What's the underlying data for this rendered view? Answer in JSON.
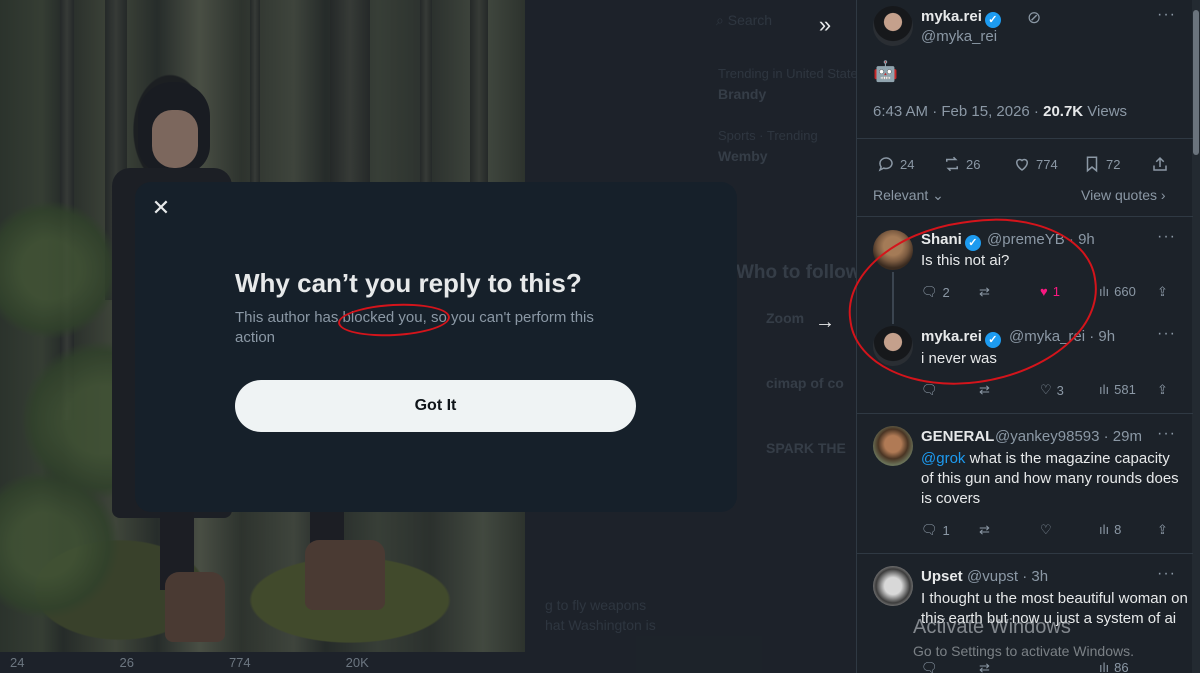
{
  "modal": {
    "title": "Why can’t you reply to this?",
    "text": "This author has blocked you, so you can't perform this action",
    "button": "Got It"
  },
  "background_column": {
    "search": "Search",
    "trending_label": "Trending in United States",
    "trending_topic": "Brandy",
    "sports_label": "Sports · Trending",
    "sports_topic": "Wemby",
    "who_to_follow": "Who to follow",
    "suggest_1": "Zoom",
    "suggest_2": "cimap of co",
    "suggest_3": "SPARK THE",
    "news_text": "g to fly weapons",
    "news_text2": "hat Washington is"
  },
  "photo_actions": {
    "replies": "24",
    "reposts": "26",
    "likes": "774",
    "views": "20K"
  },
  "post": {
    "author_name": "myka.rei",
    "author_handle": "@myka_rei",
    "emoji": "🤖",
    "time": "6:43 AM · Feb 15, 2026 · ",
    "views_count": "20.7K",
    "views_label": " Views",
    "replies": "24",
    "reposts": "26",
    "likes": "774",
    "bookmarks": "72",
    "sort": "Relevant",
    "view_quotes": "View quotes"
  },
  "replies": [
    {
      "name": "Shani",
      "handle": "@premeYB · 9h",
      "text": "Is this not ai?",
      "replies": "2",
      "reposts": "",
      "likes": "1",
      "views": "660"
    },
    {
      "name": "myka.rei",
      "handle": "@myka_rei · 9h",
      "text": "i never was",
      "replies": "",
      "reposts": "",
      "likes": "3",
      "views": "581"
    },
    {
      "name": "GENERAL",
      "handle": "@yankey98593 · 29m",
      "mention": "@grok",
      "text": " what is the magazine capacity of this gun and how many rounds does is covers",
      "replies": "1",
      "reposts": "",
      "likes": "",
      "views": "8"
    },
    {
      "name": "Upset",
      "handle": "@vupst · 3h",
      "text": "I thought u the most beautiful woman on this earth but now u just a system of ai",
      "replies": "",
      "reposts": "",
      "likes": "",
      "views": "86"
    }
  ],
  "watermark": {
    "title": "Activate Windows",
    "subtitle": "Go to Settings to activate Windows."
  },
  "colors": {
    "accent": "#1d9bf0",
    "like": "#f91880",
    "annotation": "#d4141b"
  }
}
